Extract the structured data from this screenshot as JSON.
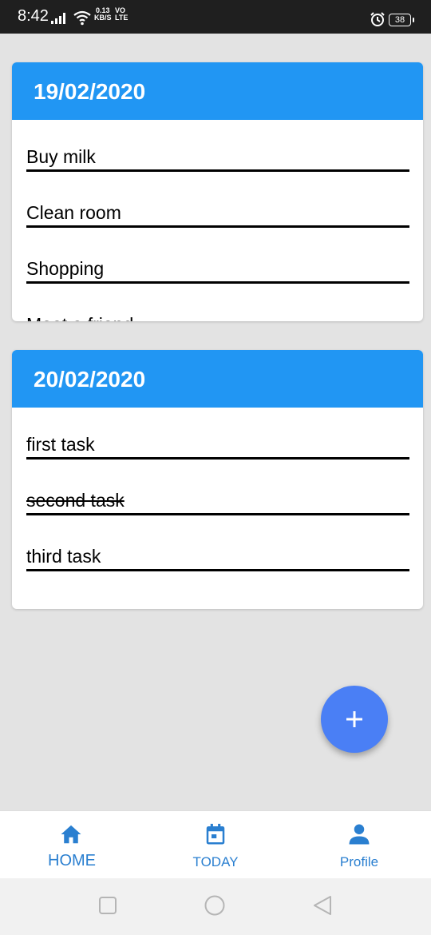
{
  "status_bar": {
    "time": "8:42",
    "speed_value": "0.13",
    "speed_unit": "KB/S",
    "volte_top": "VO",
    "volte_bottom": "LTE",
    "battery": "38"
  },
  "cards": [
    {
      "date": "19/02/2020",
      "tasks": [
        {
          "text": "Buy milk",
          "done": false
        },
        {
          "text": "Clean room",
          "done": false
        },
        {
          "text": "Shopping",
          "done": false
        },
        {
          "text": "Meet a friend",
          "done": false
        }
      ]
    },
    {
      "date": "20/02/2020",
      "tasks": [
        {
          "text": "first task",
          "done": false
        },
        {
          "text": "second task",
          "done": true
        },
        {
          "text": "third task",
          "done": false
        }
      ]
    }
  ],
  "fab": {
    "label": "+",
    "icon": "plus-icon"
  },
  "bottom_nav": {
    "home": "HOME",
    "today": "TODAY",
    "profile": "Profile"
  },
  "colors": {
    "accent": "#2196f3",
    "fab": "#4a7ff5",
    "nav_active": "#2a7fd0",
    "background": "#e3e3e3"
  }
}
